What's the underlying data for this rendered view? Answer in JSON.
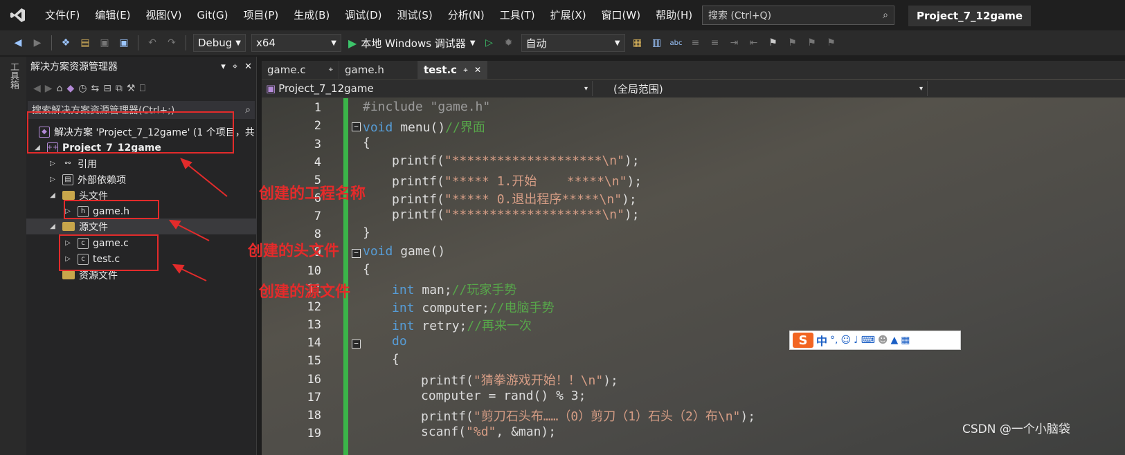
{
  "menubar": {
    "items": [
      "文件(F)",
      "编辑(E)",
      "视图(V)",
      "Git(G)",
      "项目(P)",
      "生成(B)",
      "调试(D)",
      "测试(S)",
      "分析(N)",
      "工具(T)",
      "扩展(X)",
      "窗口(W)",
      "帮助(H)"
    ],
    "search_placeholder": "搜索 (Ctrl+Q)",
    "project_title": "Project_7_12game"
  },
  "toolbar": {
    "config": "Debug",
    "platform": "x64",
    "run_label": "本地 Windows 调试器",
    "auto_select": "自动"
  },
  "toolbox": {
    "label": "工具箱"
  },
  "solution_explorer": {
    "title": "解决方案资源管理器",
    "search_placeholder": "搜索解决方案资源管理器(Ctrl+;)",
    "solution": "解决方案 'Project_7_12game' (1 个项目，共",
    "project": "Project_7_12game",
    "references": "引用",
    "external_deps": "外部依赖项",
    "header_folder": "头文件",
    "header_file": "game.h",
    "source_folder": "源文件",
    "source_file_1": "game.c",
    "source_file_2": "test.c",
    "resource_folder": "资源文件"
  },
  "editor": {
    "tabs": [
      "game.c",
      "game.h",
      "test.c"
    ],
    "active_tab": "test.c",
    "nav_project": "Project_7_12game",
    "nav_scope": "(全局范围)",
    "line_numbers": [
      "1",
      "2",
      "3",
      "4",
      "5",
      "6",
      "7",
      "8",
      "9",
      "10",
      "11",
      "12",
      "13",
      "14",
      "15",
      "16",
      "17",
      "18",
      "19"
    ]
  },
  "code": {
    "l1": "#include \"game.h\"",
    "l2_kw": "void",
    "l2_fn": " menu()",
    "l2_cm": "//界面",
    "l3": "{",
    "l4_fn": "printf(",
    "l4_st": "\"********************\\n\"",
    "l4_end": ");",
    "l5_fn": "printf(",
    "l5_st": "\"***** 1.开始    *****\\n\"",
    "l5_end": ");",
    "l6_fn": "printf(",
    "l6_st": "\"***** 0.退出程序*****\\n\"",
    "l6_end": ");",
    "l7_fn": "printf(",
    "l7_st": "\"********************\\n\"",
    "l7_end": ");",
    "l8": "}",
    "l9_kw": "void",
    "l9_fn": " game()",
    "l10": "{",
    "l11_kw": "int",
    "l11_var": " man;",
    "l11_cm": "//玩家手势",
    "l12_kw": "int",
    "l12_var": " computer;",
    "l12_cm": "//电脑手势",
    "l13_kw": "int",
    "l13_var": " retry;",
    "l13_cm": "//再来一次",
    "l14_kw": "do",
    "l15": "{",
    "l16_fn": "printf(",
    "l16_st": "\"猜拳游戏开始！！\\n\"",
    "l16_end": ");",
    "l17": "computer = rand() % 3;",
    "l18_fn": "printf(",
    "l18_st": "\"剪刀石头布……（0）剪刀（1）石头（2）布\\n\"",
    "l18_end": ");",
    "l19_fn": "scanf(",
    "l19_st": "\"%d\"",
    "l19_end": ", &man);"
  },
  "annotations": {
    "project_name": "创建的工程名称",
    "header": "创建的头文件",
    "source": "创建的源文件"
  },
  "ime": {
    "logo": "S",
    "mode": "中",
    "punct": "°,"
  },
  "watermark": "CSDN @一个小脑袋",
  "colors": {
    "keyword": "#569cd6",
    "comment": "#57a64a",
    "string": "#d69d85",
    "annotation": "#e32b2b",
    "change_bar": "#3bb449"
  }
}
